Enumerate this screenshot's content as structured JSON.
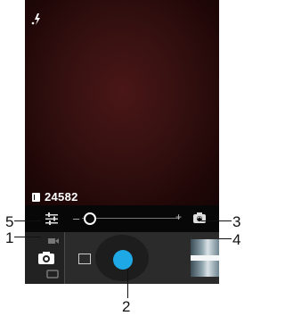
{
  "status": {
    "photos_remaining": "24582"
  },
  "zoom": {
    "minus_label": "–",
    "plus_label": "+",
    "level_fraction": 0.05
  },
  "callouts": {
    "c1": "1",
    "c2": "2",
    "c3": "3",
    "c4": "4",
    "c5": "5"
  },
  "colors": {
    "shutter": "#1ea9e6",
    "viewfinder": "#3a1010"
  },
  "icons": {
    "flash": "flash-auto-icon",
    "counter": "storage-icon",
    "settings": "settings-sliders-icon",
    "switch_camera": "switch-camera-icon",
    "mode_video": "video-mode-icon",
    "mode_camera": "camera-mode-icon",
    "mode_panorama": "panorama-mode-icon",
    "gallery": "gallery-icon"
  }
}
